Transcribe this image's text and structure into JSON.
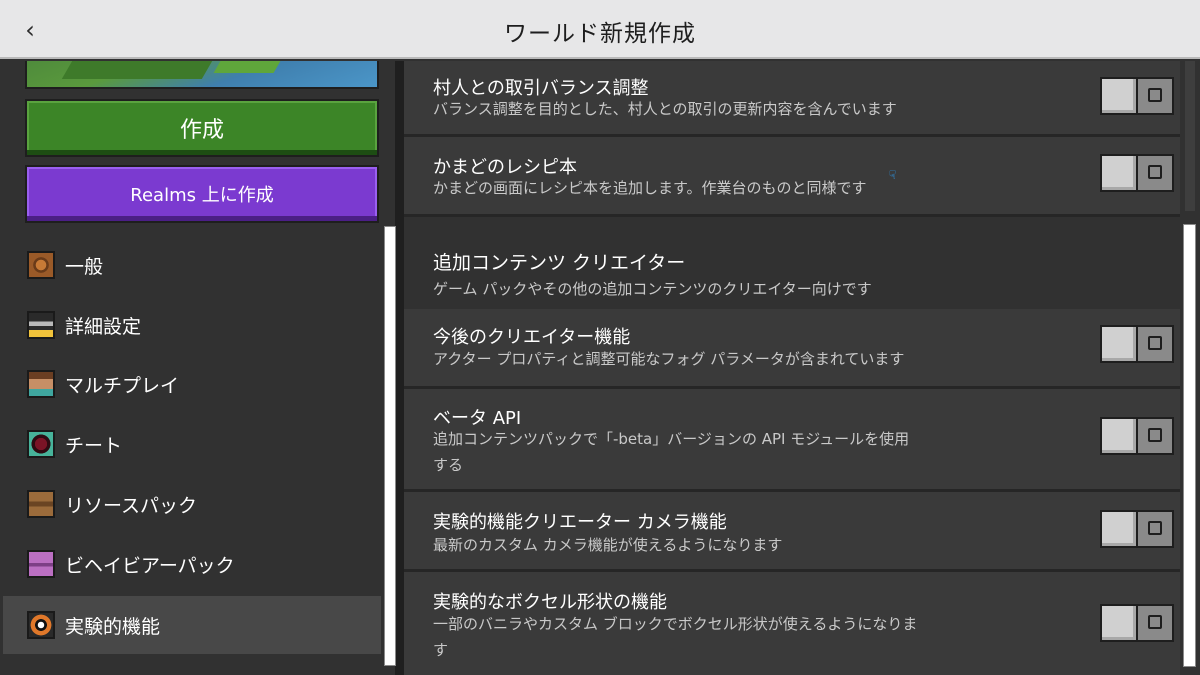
{
  "header": {
    "title": "ワールド新規作成",
    "back_icon": "chevron-left-icon"
  },
  "sidebar": {
    "create_label": "作成",
    "realms_label": "Realms 上に作成",
    "items": [
      {
        "label": "一般",
        "icon": "general-icon"
      },
      {
        "label": "詳細設定",
        "icon": "advanced-settings-icon"
      },
      {
        "label": "マルチプレイ",
        "icon": "multiplayer-icon"
      },
      {
        "label": "チート",
        "icon": "cheats-icon"
      },
      {
        "label": "リソースパック",
        "icon": "resource-pack-icon"
      },
      {
        "label": "ビヘイビアーパック",
        "icon": "behavior-pack-icon"
      },
      {
        "label": "実験的機能",
        "icon": "experiments-icon",
        "active": true
      }
    ]
  },
  "settings": {
    "rows": [
      {
        "title": "村人との取引バランス調整",
        "desc": "バランス調整を目的とした、村人との取引の更新内容を含んでいます",
        "enabled": false
      },
      {
        "title": "かまどのレシピ本",
        "desc": "かまどの画面にレシピ本を追加します。作業台のものと同様です",
        "enabled": false
      }
    ],
    "section": {
      "title": "追加コンテンツ クリエイター",
      "desc": "ゲーム パックやその他の追加コンテンツのクリエイター向けです"
    },
    "creator_rows": [
      {
        "title": "今後のクリエイター機能",
        "desc": "アクター プロパティと調整可能なフォグ パラメータが含まれています",
        "enabled": false
      },
      {
        "title": "ベータ API",
        "desc_line1": "追加コンテンツパックで「-beta」バージョンの API モジュールを使用",
        "desc_line2": "する",
        "enabled": false
      },
      {
        "title": "実験的機能クリエーター カメラ機能",
        "desc": "最新のカスタム カメラ機能が使えるようになります",
        "enabled": false
      },
      {
        "title": "実験的なボクセル形状の機能",
        "desc_line1": "一部のバニラやカスタム ブロックでボクセル形状が使えるようになりま",
        "desc_line2": "す",
        "enabled": false
      }
    ]
  }
}
